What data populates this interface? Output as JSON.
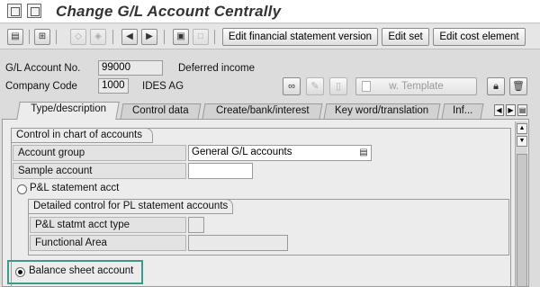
{
  "window": {
    "title": "Change G/L Account Centrally"
  },
  "toolbar": {
    "buttons": [
      "Edit financial statement version",
      "Edit set",
      "Edit cost element"
    ]
  },
  "header": {
    "gl_account_label": "G/L Account No.",
    "gl_account_value": "99000",
    "gl_account_desc": "Deferred income",
    "company_code_label": "Company Code",
    "company_code_value": "1000",
    "company_code_desc": "IDES AG",
    "template_button": "w. Template"
  },
  "tabs": [
    "Type/description",
    "Control data",
    "Create/bank/interest",
    "Key word/translation",
    "Inf..."
  ],
  "chart_group": {
    "title": "Control in chart of accounts",
    "account_group_label": "Account group",
    "account_group_value": "General G/L accounts",
    "sample_account_label": "Sample account",
    "sample_account_value": "",
    "pl_radio_label": "P&L statement acct",
    "pl_radio_selected": false,
    "detail_group_title": "Detailed control for PL statement accounts",
    "pl_type_label": "P&L statmt acct type",
    "pl_type_value": "",
    "functional_area_label": "Functional Area",
    "functional_area_value": "",
    "balance_radio_label": "Balance sheet account",
    "balance_radio_selected": true
  },
  "icons": {
    "title_icons": [
      "history-icon",
      "layout-icon"
    ],
    "toolbar_icons": [
      "save-icon",
      "hierarchy-icon",
      "other-account-icon",
      "compare-icon",
      "previous-icon",
      "next-icon",
      "print-icon",
      "select-icon"
    ],
    "header_icons": [
      "glasses-icon",
      "edit-icon",
      "document-icon",
      "lock-icon",
      "delete-icon"
    ]
  }
}
